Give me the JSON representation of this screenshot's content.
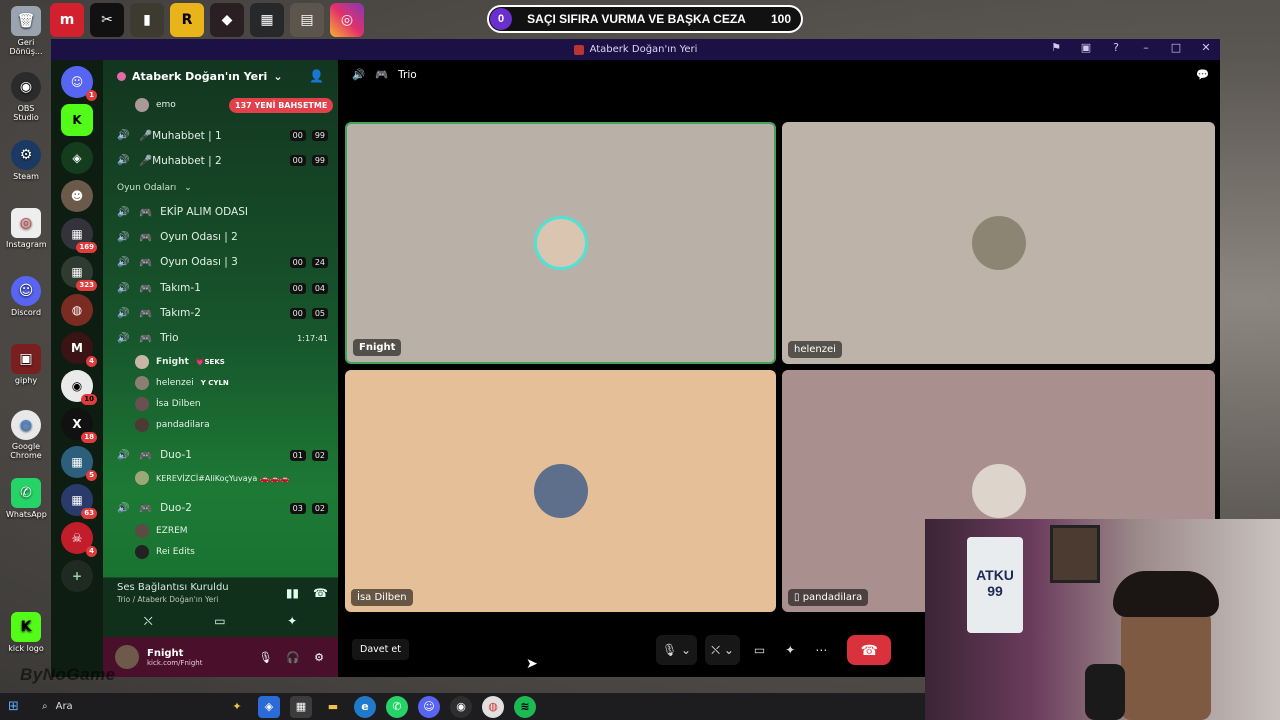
{
  "desktop_icons": [
    {
      "label": "Geri Dönüş...",
      "icon": "recycle-bin-icon",
      "color": "#9aa4b0"
    },
    {
      "label": "OBS Studio",
      "icon": "obs-icon",
      "color": "#2b2b2b"
    },
    {
      "label": "Steam",
      "icon": "steam-icon",
      "color": "#1b3a63"
    },
    {
      "label": "Instagram",
      "icon": "chrome-app-icon",
      "color": "#eeeeee"
    },
    {
      "label": "Discord",
      "icon": "discord-icon",
      "color": "#5865f2"
    },
    {
      "label": "giphy",
      "icon": "giphy-icon",
      "color": "#7a1f1f"
    },
    {
      "label": "Google Chrome",
      "icon": "chrome-icon",
      "color": "#e8e8e8"
    },
    {
      "label": "WhatsApp",
      "icon": "whatsapp-icon",
      "color": "#25d366"
    },
    {
      "label": "kick logo",
      "icon": "kick-icon",
      "color": "#53fc18"
    }
  ],
  "goal_bar": {
    "left_value": "0",
    "title": "SAÇI SIFIRA VURMA VE BAŞKA CEZA",
    "right_value": "100"
  },
  "window": {
    "title": "Ataberk Doğan'ın Yeri"
  },
  "server": {
    "name": "Ataberk Doğan'ın Yeri",
    "mention_pill": "137 YENİ BAHSETME",
    "top_member": "emo",
    "category": "Oyun Odaları",
    "channels": [
      {
        "name": "🎤Muhabbet | 1",
        "count_a": "00",
        "count_b": "99"
      },
      {
        "name": "🎤Muhabbet | 2",
        "count_a": "00",
        "count_b": "99"
      },
      {
        "name": "EKİP ALIM ODASI"
      },
      {
        "name": "Oyun Odası | 2"
      },
      {
        "name": "Oyun Odası | 3",
        "count_a": "00",
        "count_b": "24"
      },
      {
        "name": "Takım-1",
        "count_a": "00",
        "count_b": "04"
      },
      {
        "name": "Takım-2",
        "count_a": "00",
        "count_b": "05"
      },
      {
        "name": "Trio",
        "timer": "1:17:41"
      },
      {
        "name": "Duo-1",
        "count_a": "01",
        "count_b": "02"
      },
      {
        "name": "Duo-2",
        "count_a": "03",
        "count_b": "02"
      }
    ],
    "trio_members": [
      {
        "name": "Fnight",
        "tag": "💗SEKS"
      },
      {
        "name": "helenzei",
        "tag": "Y CYLN"
      },
      {
        "name": "İsa Dilben",
        "tag": ""
      },
      {
        "name": "pandadilara",
        "tag": ""
      }
    ],
    "duo1_member": "KEREVİZCİ#AliKoçYuvaya 🚗🚗🚗",
    "duo2_members": [
      "EZREM",
      "Rei Edits"
    ]
  },
  "server_badges": [
    "1",
    "169",
    "323",
    "4",
    "10",
    "18",
    "5",
    "63",
    "4"
  ],
  "voice": {
    "status": "Ses Bağlantısı Kuruldu",
    "channel": "Trio / Ataberk Doğan'ın Yeri"
  },
  "user": {
    "name": "Fnight",
    "status": "kick.com/Fnight"
  },
  "stage": {
    "channel": "Trio",
    "tiles": [
      {
        "name": "Fnight"
      },
      {
        "name": "helenzei"
      },
      {
        "name": "İsa Dilben"
      },
      {
        "name": "pandadilara"
      }
    ],
    "invite_label": "Davet et"
  },
  "webcam": {
    "shirt_text": "ATKU 99"
  },
  "taskbar": {
    "search_label": "Ara"
  },
  "watermark": "ByNoGame"
}
